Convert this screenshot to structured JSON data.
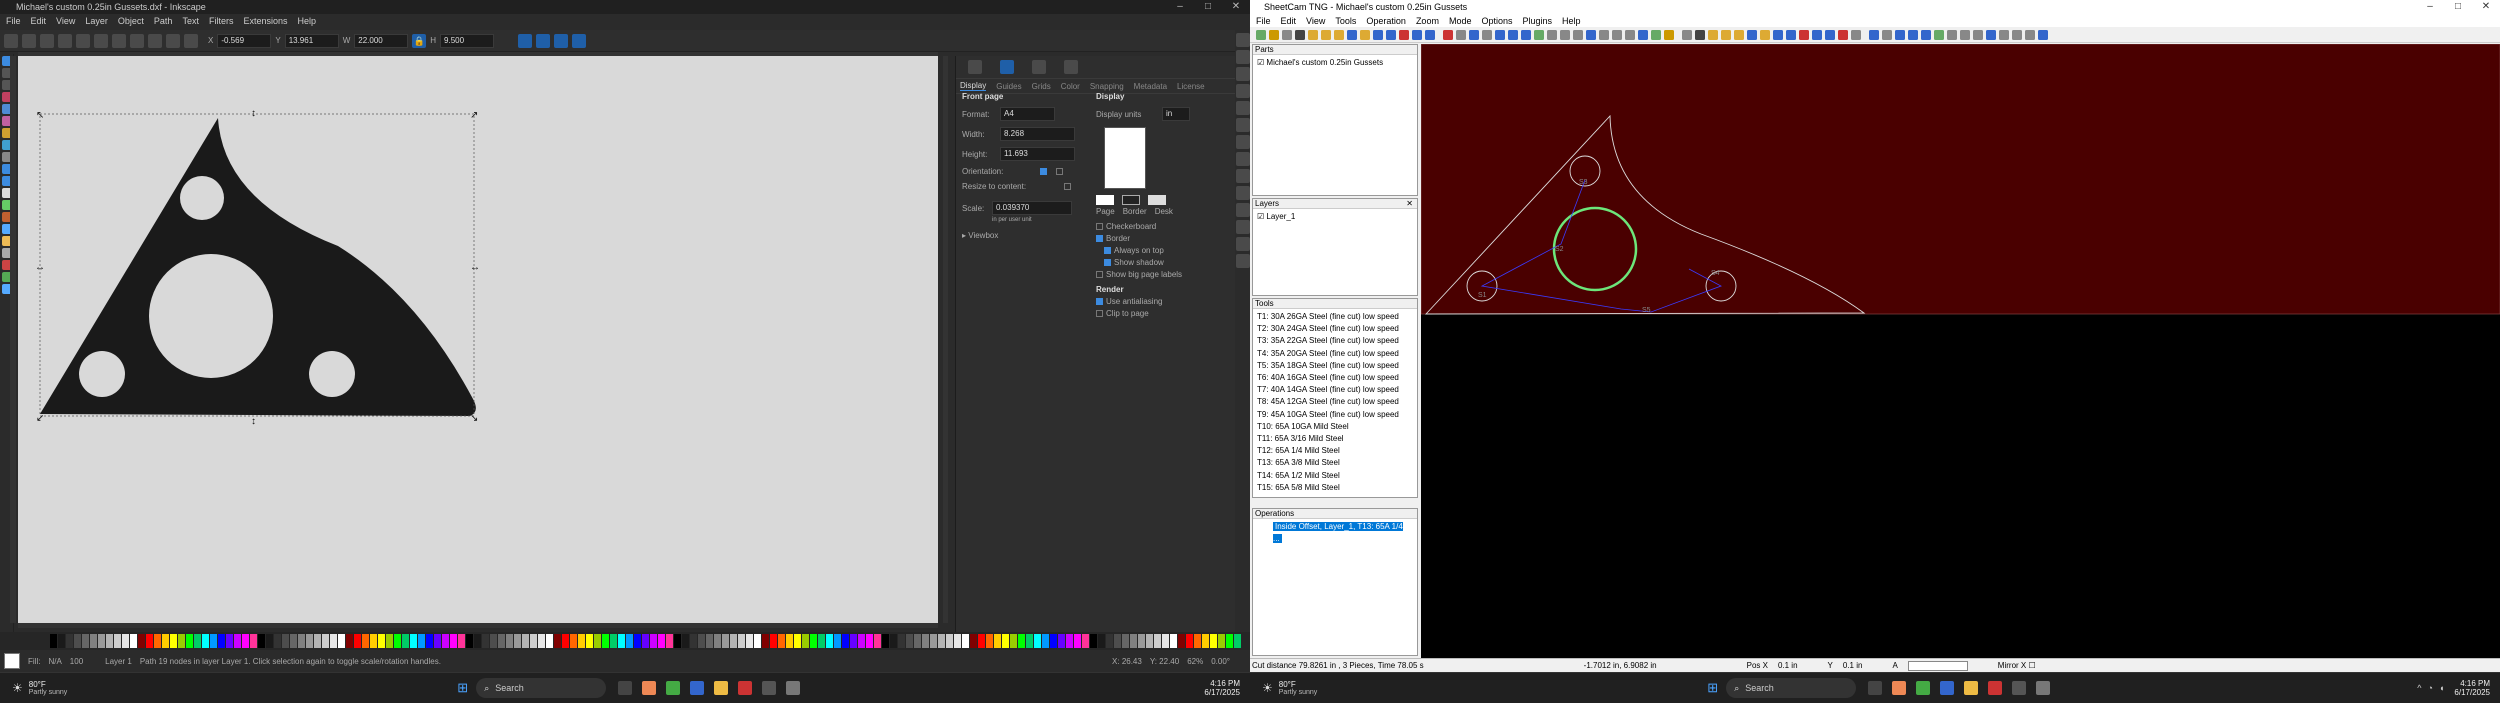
{
  "inkscape": {
    "title": "Michael's custom 0.25in Gussets.dxf - Inkscape",
    "menu": [
      "File",
      "Edit",
      "View",
      "Layer",
      "Object",
      "Path",
      "Text",
      "Filters",
      "Extensions",
      "Help"
    ],
    "ctrl": {
      "x": "-0.569",
      "y": "13.961",
      "w": "22.000",
      "h": "9.500"
    },
    "panel_tabs": [
      "Display",
      "Guides",
      "Grids",
      "Color",
      "Snapping",
      "Metadata",
      "License"
    ],
    "front_page": "Front page",
    "format_label": "Format:",
    "format_value": "A4",
    "width_label": "Width:",
    "width_value": "8.268",
    "height_label": "Height:",
    "height_value": "11.693",
    "orientation_label": "Orientation:",
    "resize_label": "Resize to content:",
    "scale_label": "Scale:",
    "scale_value": "0.039370",
    "scale_note": "in per user unit",
    "viewbox_label": "Viewbox",
    "display_head": "Display",
    "display_units_label": "Display units",
    "display_units_value": "in",
    "swatch_labels": [
      "Page",
      "Border",
      "Desk"
    ],
    "checkerboard": "Checkerboard",
    "border": "Border",
    "always_on_top": "Always on top",
    "show_shadow": "Show shadow",
    "show_labels": "Show big page labels",
    "render_head": "Render",
    "antialias": "Use antialiasing",
    "clip": "Clip to page",
    "status_layer": "Layer 1",
    "status_msg": "Path 19 nodes in layer Layer 1. Click selection again to toggle scale/rotation handles.",
    "status_x": "X: 26.43",
    "status_y": "Y: 22.40",
    "zoom": "62%",
    "rotation": "0.00°",
    "fill_label": "Fill:",
    "stroke_label": "Stroke:",
    "fill_none": "N/A",
    "opacity": "100",
    "unset": "Unset"
  },
  "sheetcam": {
    "title": "SheetCam TNG - Michael's custom 0.25in Gussets",
    "menu": [
      "File",
      "Edit",
      "View",
      "Tools",
      "Operation",
      "Zoom",
      "Mode",
      "Options",
      "Plugins",
      "Help"
    ],
    "parts_head": "Parts",
    "parts": [
      "Michael's custom 0.25in Gussets"
    ],
    "layers_head": "Layers",
    "layers": [
      "Layer_1"
    ],
    "tools_head": "Tools",
    "tools": [
      "T1: 30A 26GA Steel (fine cut) low speed",
      "T2: 30A 24GA Steel (fine cut) low speed",
      "T3: 35A 22GA Steel (fine cut) low speed",
      "T4: 35A 20GA Steel (fine cut) low speed",
      "T5: 35A 18GA Steel (fine cut) low speed",
      "T6: 40A 16GA Steel (fine cut) low speed",
      "T7: 40A 14GA Steel (fine cut) low speed",
      "T8: 45A 12GA Steel (fine cut) low speed",
      "T9: 45A 10GA Steel (fine cut) low speed",
      "T10: 65A 10GA Mild Steel",
      "T11: 65A 3/16 Mild Steel",
      "T12: 65A 1/4 Mild Steel",
      "T13: 65A 3/8 Mild Steel",
      "T14: 65A 1/2 Mild Steel",
      "T15: 65A 5/8 Mild Steel"
    ],
    "operations_head": "Operations",
    "operations": [
      "Inside Offset, Layer_1, T13: 65A 1/4 ..."
    ],
    "status_cut": "Cut distance 79.8261 in , 3 Pieces, Time 78.05 s",
    "status_coord": "-1.7012 in, 6.9082 in",
    "pos_x_label": "Pos X",
    "pos_x": "0.1 in",
    "pos_y_label": "Y",
    "pos_y": "0.1 in",
    "a_label": "A",
    "mirror_label": "Mirror X"
  },
  "taskbar": {
    "weather_temp": "80°F",
    "weather_desc": "Partly sunny",
    "search": "Search",
    "time": "4:16 PM",
    "date": "6/17/2025"
  }
}
